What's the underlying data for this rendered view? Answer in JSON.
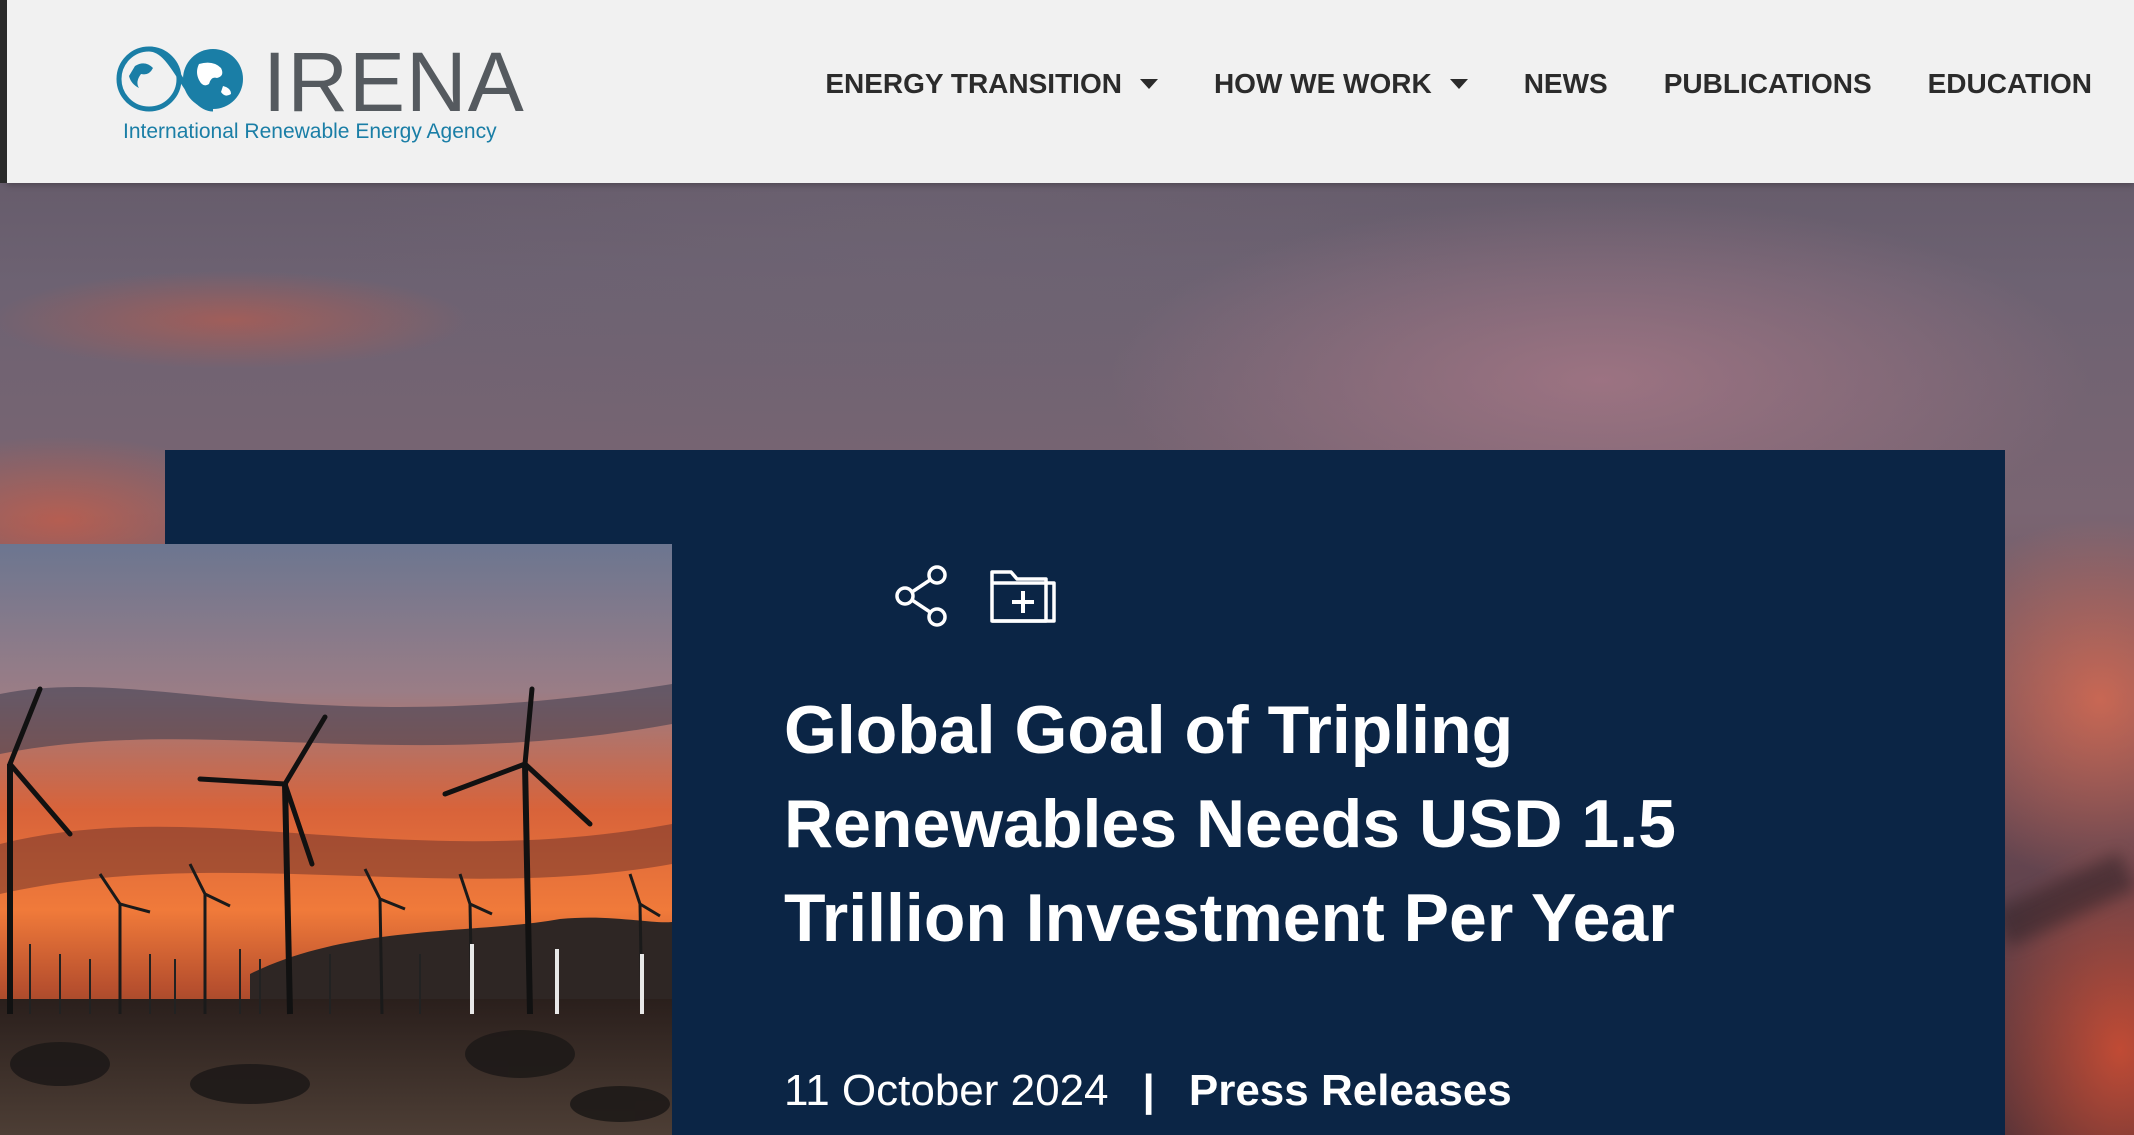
{
  "brand": {
    "name": "IRENA",
    "tagline": "International Renewable Energy Agency"
  },
  "nav": {
    "items": [
      {
        "label": "ENERGY TRANSITION",
        "has_dropdown": true
      },
      {
        "label": "HOW WE WORK",
        "has_dropdown": true
      },
      {
        "label": "NEWS",
        "has_dropdown": false
      },
      {
        "label": "PUBLICATIONS",
        "has_dropdown": false
      },
      {
        "label": "EDUCATION",
        "has_dropdown": false
      }
    ]
  },
  "article": {
    "title": "Global Goal of Tripling Renewables Needs USD 1.5 Trillion Investment Per Year",
    "date": "11 October 2024",
    "separator": "|",
    "category": "Press Releases",
    "actions": [
      {
        "icon": "share-icon"
      },
      {
        "icon": "folder-add-icon"
      }
    ],
    "image": "wind-turbines-sunset-photo"
  },
  "colors": {
    "header_bg": "#f1f1f1",
    "card_bg": "#0b2545",
    "brand_blue": "#1a7ea6",
    "logo_gray": "#555a5f",
    "nav_text": "#2b2b2b"
  }
}
